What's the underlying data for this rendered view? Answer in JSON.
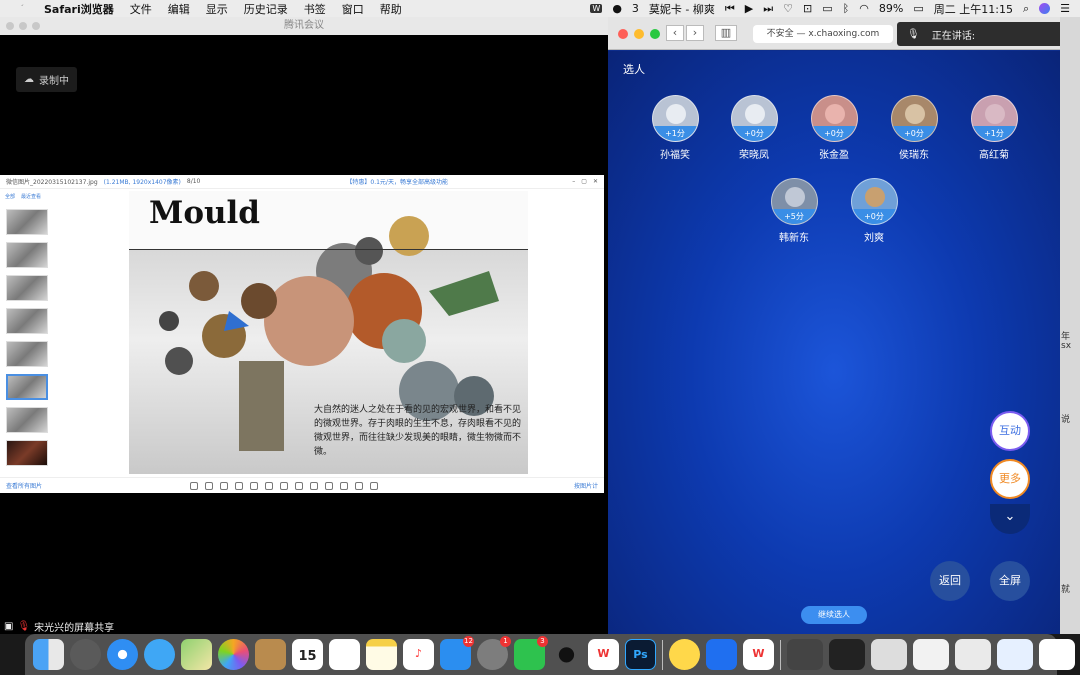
{
  "menubar": {
    "app": "Safari浏览器",
    "items": [
      "文件",
      "编辑",
      "显示",
      "历史记录",
      "书签",
      "窗口",
      "帮助"
    ],
    "wechat_count": "3",
    "now_playing": "莫妮卡 - 柳爽",
    "battery": "89%",
    "datetime": "周二 上午11:15"
  },
  "meeting": {
    "title": "腾讯会议",
    "record_label": "录制中",
    "share_label": "宋光兴的屏幕共享"
  },
  "viewer": {
    "filename": "微信图片_20220315102137.jpg",
    "fileinfo": "(1.21MB, 1920x1407像素)",
    "page": "8/10",
    "promo": "【特惠】0.1元/天，畅享全部高级功能",
    "tab_all": "全部",
    "tab_recent": "最近查看",
    "bottom_left": "查看所有图片",
    "bottom_right": "按图片计",
    "poster_title": "Mould",
    "poster_text": "大自然的迷人之处在于看的见的宏观世界，和看不见的微观世界。存于肉眼的生生不息，存肉眼看不见的微观世界，而往往缺少发现美的眼睛，微生物微而不微。"
  },
  "safari": {
    "url": "不安全 — x.chaoxing.com",
    "heading": "选人",
    "students": [
      {
        "name": "孙福笑",
        "score": "+1分"
      },
      {
        "name": "荣晓凤",
        "score": "+0分"
      },
      {
        "name": "张金盈",
        "score": "+0分"
      },
      {
        "name": "侯瑞东",
        "score": "+0分"
      },
      {
        "name": "高红菊",
        "score": "+1分"
      },
      {
        "name": "韩新东",
        "score": "+5分"
      },
      {
        "name": "刘爽",
        "score": "+0分"
      }
    ],
    "btn_interact": "互动",
    "btn_more": "更多",
    "btn_back": "返回",
    "btn_fullscreen": "全屏",
    "btn_continue": "继续选人"
  },
  "speaking": {
    "label": "正在讲话:"
  },
  "edge": {
    "t1": "年",
    "t2": "sx",
    "t3": "说",
    "t4": "就"
  },
  "dock": {
    "calendar_day": "15",
    "calendar_month": "3月",
    "appstore_badge": "12",
    "settings_badge": "1",
    "wechat_badge": "3",
    "ps_label": "Ps"
  }
}
